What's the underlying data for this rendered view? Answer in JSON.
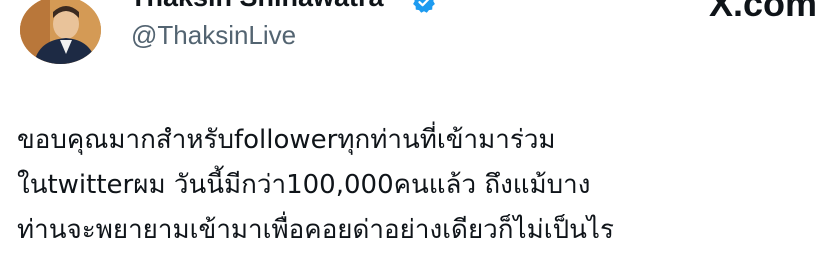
{
  "author": {
    "display_name": "Thaksin Shinawatra",
    "handle": "@ThaksinLive",
    "verified": true,
    "avatar_icon": "profile-photo"
  },
  "watermark": "X.com",
  "tweet": {
    "lines": [
      "ขอบคุณมากสำหรับfollowerทุกท่านที่เข้ามาร่วม",
      "ในtwitterผม วันนี้มีกว่า100,000คนแล้ว ถึงแม้บาง",
      "ท่านจะพยายามเข้ามาเพื่อคอยด่าอย่างเดียวก็ไม่เป็นไร"
    ]
  },
  "colors": {
    "text": "#0f1419",
    "secondary": "#536471",
    "verified": "#1d9bf0"
  }
}
